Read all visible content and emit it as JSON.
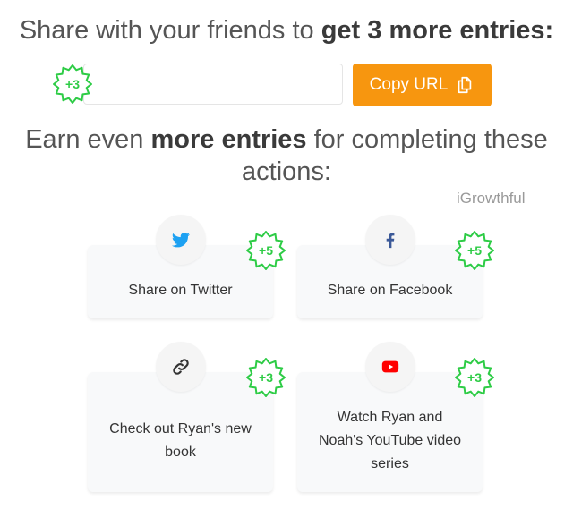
{
  "share": {
    "prefix": "Share with your friends to ",
    "bold": "get 3 more entries:"
  },
  "url_box": {
    "value": "",
    "badge": "+3",
    "copy_label": "Copy URL",
    "copy_icon": "copy-icon"
  },
  "earn": {
    "pre": "Earn even ",
    "bold": "more entries",
    "post": " for completing these actions:"
  },
  "watermark": "iGrowthful",
  "actions": [
    {
      "label": "Share on Twitter",
      "badge": "+5",
      "icon": "twitter-icon"
    },
    {
      "label": "Share on Facebook",
      "badge": "+5",
      "icon": "facebook-icon"
    },
    {
      "label": "Check out Ryan's new book",
      "badge": "+3",
      "icon": "link-icon"
    },
    {
      "label": "Watch Ryan and Noah's YouTube video series",
      "badge": "+3",
      "icon": "youtube-icon"
    }
  ],
  "colors": {
    "accent": "#f7960f",
    "badge_green": "#2ecc46",
    "twitter": "#1da1f2",
    "facebook": "#3b5998",
    "youtube": "#ff0000"
  }
}
